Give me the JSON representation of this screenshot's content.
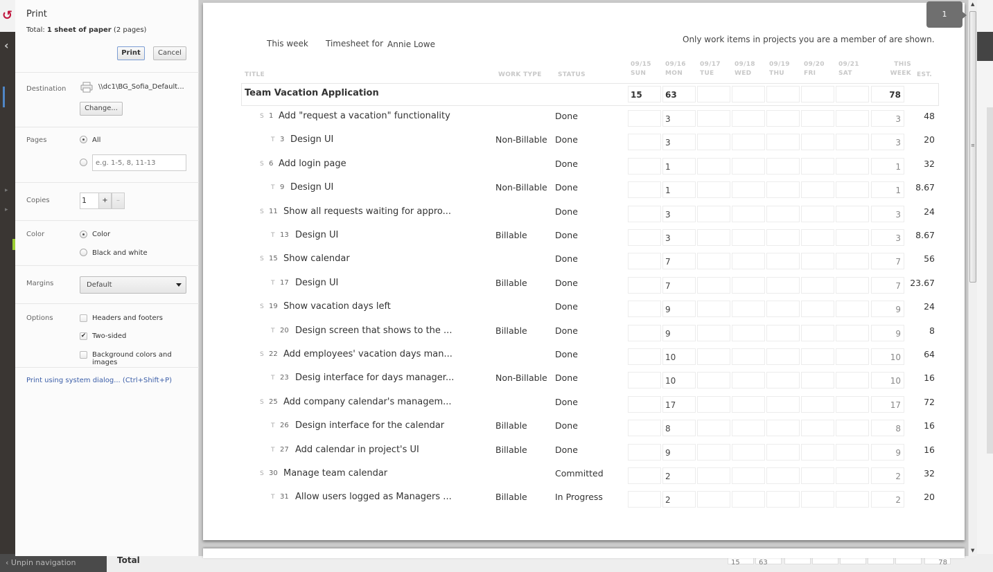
{
  "print_panel": {
    "title": "Print",
    "total_prefix": "Total: ",
    "total_bold": "1 sheet of paper",
    "total_suffix": " (2 pages)",
    "print_label": "Print",
    "cancel_label": "Cancel",
    "destination_label": "Destination",
    "destination_value": "\\\\dc1\\BG_Sofia_Default...",
    "change_label": "Change...",
    "pages_label": "Pages",
    "pages_all_label": "All",
    "pages_placeholder": "e.g. 1-5, 8, 11-13",
    "pages_selected": "All",
    "copies_label": "Copies",
    "copies_value": "1",
    "copies_plus": "+",
    "copies_minus": "–",
    "color_label": "Color",
    "color_option_color": "Color",
    "color_option_bw": "Black and white",
    "color_selected": "Color",
    "margins_label": "Margins",
    "margins_value": "Default",
    "options_label": "Options",
    "opt_headers_footers": "Headers and footers",
    "opt_two_sided": "Two-sided",
    "opt_background": "Background colors and images",
    "opt_headers_footers_checked": false,
    "opt_two_sided_checked": true,
    "opt_background_checked": false,
    "system_dialog_link": "Print using system dialog... (Ctrl+Shift+P)",
    "check_glyph": "✔"
  },
  "app": {
    "unpin_label": "‹ Unpin navigation",
    "bg_total_label": "Total",
    "bg_total_values": [
      "15",
      "63",
      "",
      "",
      "",
      "",
      "",
      "78"
    ]
  },
  "preview": {
    "page_indicator": "1"
  },
  "timesheet": {
    "range_label": "This week",
    "timesheet_for_label": "Timesheet for",
    "user_name": "Annie Lowe",
    "notice": "Only work items in projects you are a member of are shown.",
    "columns": {
      "title": "TITLE",
      "work_type": "WORK TYPE",
      "status": "STATUS",
      "days": [
        {
          "date": "09/15",
          "day": "SUN"
        },
        {
          "date": "09/16",
          "day": "MON"
        },
        {
          "date": "09/17",
          "day": "TUE"
        },
        {
          "date": "09/18",
          "day": "WED"
        },
        {
          "date": "09/19",
          "day": "THU"
        },
        {
          "date": "09/20",
          "day": "FRI"
        },
        {
          "date": "09/21",
          "day": "SAT"
        }
      ],
      "this_week_1": "THIS",
      "this_week_2": "WEEK",
      "est": "EST."
    },
    "project": {
      "title": "Team Vacation Application",
      "days": [
        "15",
        "63",
        "",
        "",
        "",
        "",
        ""
      ],
      "this_week": "78"
    },
    "rows": [
      {
        "kind": "S",
        "id": "1",
        "title": "Add \"request a vacation\" functionality",
        "work_type": "",
        "status": "Done",
        "days": [
          "",
          "3",
          "",
          "",
          "",
          "",
          ""
        ],
        "this_week": "3",
        "est": "48"
      },
      {
        "kind": "T",
        "id": "3",
        "title": "Design UI",
        "work_type": "Non-Billable",
        "status": "Done",
        "days": [
          "",
          "3",
          "",
          "",
          "",
          "",
          ""
        ],
        "this_week": "3",
        "est": "20"
      },
      {
        "kind": "S",
        "id": "6",
        "title": "Add login page",
        "work_type": "",
        "status": "Done",
        "days": [
          "",
          "1",
          "",
          "",
          "",
          "",
          ""
        ],
        "this_week": "1",
        "est": "32"
      },
      {
        "kind": "T",
        "id": "9",
        "title": "Design UI",
        "work_type": "Non-Billable",
        "status": "Done",
        "days": [
          "",
          "1",
          "",
          "",
          "",
          "",
          ""
        ],
        "this_week": "1",
        "est": "8.67"
      },
      {
        "kind": "S",
        "id": "11",
        "title": "Show all requests waiting for appro...",
        "work_type": "",
        "status": "Done",
        "days": [
          "",
          "3",
          "",
          "",
          "",
          "",
          ""
        ],
        "this_week": "3",
        "est": "24"
      },
      {
        "kind": "T",
        "id": "13",
        "title": "Design UI",
        "work_type": "Billable",
        "status": "Done",
        "days": [
          "",
          "3",
          "",
          "",
          "",
          "",
          ""
        ],
        "this_week": "3",
        "est": "8.67"
      },
      {
        "kind": "S",
        "id": "15",
        "title": "Show calendar",
        "work_type": "",
        "status": "Done",
        "days": [
          "",
          "7",
          "",
          "",
          "",
          "",
          ""
        ],
        "this_week": "7",
        "est": "56"
      },
      {
        "kind": "T",
        "id": "17",
        "title": "Design UI",
        "work_type": "Billable",
        "status": "Done",
        "days": [
          "",
          "7",
          "",
          "",
          "",
          "",
          ""
        ],
        "this_week": "7",
        "est": "23.67"
      },
      {
        "kind": "S",
        "id": "19",
        "title": "Show vacation days left",
        "work_type": "",
        "status": "Done",
        "days": [
          "",
          "9",
          "",
          "",
          "",
          "",
          ""
        ],
        "this_week": "9",
        "est": "24"
      },
      {
        "kind": "T",
        "id": "20",
        "title": "Design screen that shows to the ...",
        "work_type": "Billable",
        "status": "Done",
        "days": [
          "",
          "9",
          "",
          "",
          "",
          "",
          ""
        ],
        "this_week": "9",
        "est": "8"
      },
      {
        "kind": "S",
        "id": "22",
        "title": "Add employees' vacation days man...",
        "work_type": "",
        "status": "Done",
        "days": [
          "",
          "10",
          "",
          "",
          "",
          "",
          ""
        ],
        "this_week": "10",
        "est": "64"
      },
      {
        "kind": "T",
        "id": "23",
        "title": "Desig interface for days manager...",
        "work_type": "Non-Billable",
        "status": "Done",
        "days": [
          "",
          "10",
          "",
          "",
          "",
          "",
          ""
        ],
        "this_week": "10",
        "est": "16"
      },
      {
        "kind": "S",
        "id": "25",
        "title": "Add company calendar's managem...",
        "work_type": "",
        "status": "Done",
        "days": [
          "",
          "17",
          "",
          "",
          "",
          "",
          ""
        ],
        "this_week": "17",
        "est": "72"
      },
      {
        "kind": "T",
        "id": "26",
        "title": "Design interface for the calendar",
        "work_type": "Billable",
        "status": "Done",
        "days": [
          "",
          "8",
          "",
          "",
          "",
          "",
          ""
        ],
        "this_week": "8",
        "est": "16"
      },
      {
        "kind": "T",
        "id": "27",
        "title": "Add calendar in project's UI",
        "work_type": "Billable",
        "status": "Done",
        "days": [
          "",
          "9",
          "",
          "",
          "",
          "",
          ""
        ],
        "this_week": "9",
        "est": "16"
      },
      {
        "kind": "S",
        "id": "30",
        "title": "Manage team calendar",
        "work_type": "",
        "status": "Committed",
        "days": [
          "",
          "2",
          "",
          "",
          "",
          "",
          ""
        ],
        "this_week": "2",
        "est": "32"
      },
      {
        "kind": "T",
        "id": "31",
        "title": "Allow users logged as Managers ...",
        "work_type": "Billable",
        "status": "In Progress",
        "days": [
          "",
          "2",
          "",
          "",
          "",
          "",
          ""
        ],
        "this_week": "2",
        "est": "20"
      }
    ]
  }
}
